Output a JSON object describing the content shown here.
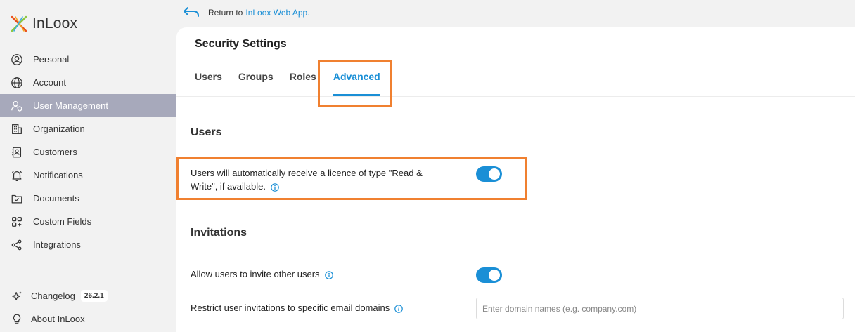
{
  "app": {
    "name": "InLoox"
  },
  "sidebar": {
    "items": [
      {
        "label": "Personal",
        "icon": "user-circle-icon"
      },
      {
        "label": "Account",
        "icon": "globe-icon"
      },
      {
        "label": "User Management",
        "icon": "user-shield-icon",
        "active": true
      },
      {
        "label": "Organization",
        "icon": "building-icon"
      },
      {
        "label": "Customers",
        "icon": "contact-book-icon"
      },
      {
        "label": "Notifications",
        "icon": "bell-icon"
      },
      {
        "label": "Documents",
        "icon": "folder-check-icon"
      },
      {
        "label": "Custom Fields",
        "icon": "grid-plus-icon"
      },
      {
        "label": "Integrations",
        "icon": "share-nodes-icon"
      }
    ],
    "bottom": [
      {
        "label": "Changelog",
        "icon": "sparkle-icon",
        "badge": "26.2.1"
      },
      {
        "label": "About InLoox",
        "icon": "lightbulb-icon"
      }
    ]
  },
  "topbar": {
    "return_text": "Return to",
    "return_link": "InLoox Web App."
  },
  "panel": {
    "title": "Security Settings",
    "tabs": [
      {
        "label": "Users"
      },
      {
        "label": "Groups"
      },
      {
        "label": "Roles"
      },
      {
        "label": "Advanced",
        "active": true
      }
    ]
  },
  "users_section": {
    "title": "Users",
    "auto_licence_label_line1": "Users will automatically receive a licence of type \"Read &",
    "auto_licence_label_line2": "Write\", if available.",
    "auto_licence_enabled": true
  },
  "invitations_section": {
    "title": "Invitations",
    "allow_invite_label": "Allow users to invite other users",
    "allow_invite_enabled": true,
    "restrict_label": "Restrict user invitations to specific email domains",
    "domain_placeholder": "Enter domain names (e.g. company.com)",
    "domain_value": ""
  },
  "colors": {
    "accent": "#1a8fd6",
    "highlight": "#f08030",
    "sidebar_active": "#a7a9bb"
  }
}
